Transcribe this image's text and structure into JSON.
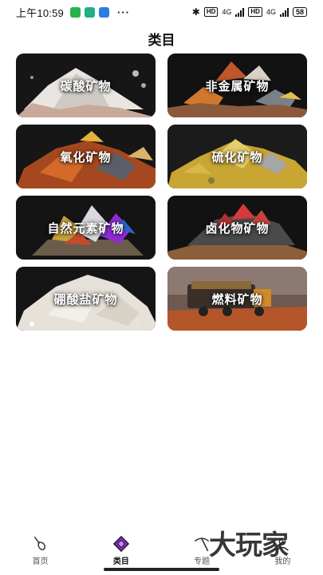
{
  "status_bar": {
    "time": "上午10:59",
    "dots": "···",
    "battery": "58",
    "hd1": "HD",
    "hd2": "HD",
    "net1": "4G",
    "net2": "4G"
  },
  "page": {
    "title": "类目"
  },
  "categories": [
    {
      "label": "碳酸矿物",
      "icon": "carbonate-minerals-image"
    },
    {
      "label": "非金属矿物",
      "icon": "nonmetal-minerals-image"
    },
    {
      "label": "氧化矿物",
      "icon": "oxide-minerals-image"
    },
    {
      "label": "硫化矿物",
      "icon": "sulfide-minerals-image"
    },
    {
      "label": "自然元素矿物",
      "icon": "native-element-minerals-image"
    },
    {
      "label": "卤化物矿物",
      "icon": "halide-minerals-image"
    },
    {
      "label": "硼酸盐矿物",
      "icon": "borate-minerals-image"
    },
    {
      "label": "燃料矿物",
      "icon": "fuel-minerals-image"
    }
  ],
  "tabbar": {
    "tabs": [
      {
        "label": "首页",
        "icon": "shovel-icon"
      },
      {
        "label": "类目",
        "icon": "gem-icon"
      },
      {
        "label": "专题",
        "icon": "pickaxe-icon"
      },
      {
        "label": "我的",
        "icon": "profile-icon"
      }
    ],
    "active_index": 1
  },
  "watermark": "大玩家",
  "colors": {
    "accent": "#8e2bd6",
    "text": "#111111",
    "background": "#ffffff"
  }
}
